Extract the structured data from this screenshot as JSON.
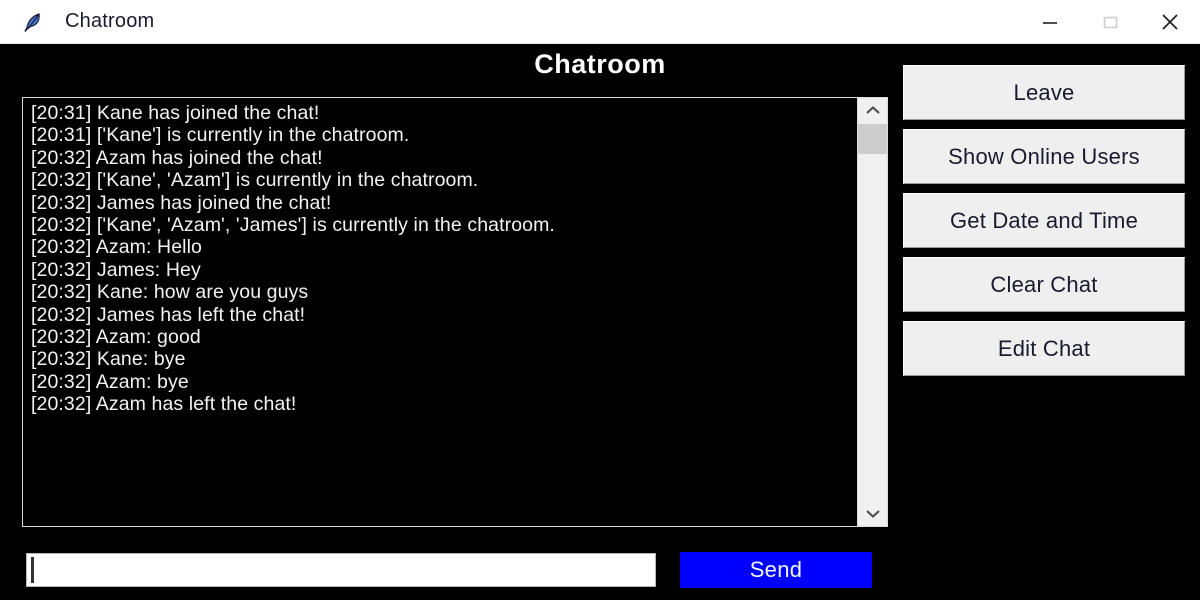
{
  "window": {
    "title": "Chatroom",
    "icon": "feather-icon",
    "controls": [
      {
        "name": "minimize-button",
        "glyph": "minimize-icon"
      },
      {
        "name": "maximize-button",
        "glyph": "maximize-icon"
      },
      {
        "name": "close-button",
        "glyph": "close-icon"
      }
    ]
  },
  "heading": "Chatroom",
  "chat": {
    "lines": [
      "[20:31] Kane has joined the chat!",
      "[20:31] ['Kane'] is currently in the chatroom.",
      "[20:32] Azam has joined the chat!",
      "[20:32] ['Kane', 'Azam'] is currently in the chatroom.",
      "[20:32] James has joined the chat!",
      "[20:32] ['Kane', 'Azam', 'James'] is currently in the chatroom.",
      "[20:32] Azam: Hello",
      "[20:32] James: Hey",
      "[20:32] Kane: how are you guys",
      "[20:32] James has left the chat!",
      "[20:32] Azam: good",
      "[20:32] Kane: bye",
      "[20:32] Azam: bye",
      "[20:32] Azam has left the chat!"
    ],
    "scrollbar": {
      "up_arrow": "chevron-up-icon",
      "down_arrow": "chevron-down-icon"
    }
  },
  "buttons": [
    {
      "name": "leave-button",
      "label": "Leave"
    },
    {
      "name": "show-online-users-button",
      "label": "Show Online Users"
    },
    {
      "name": "get-date-and-time-button",
      "label": "Get Date and Time"
    },
    {
      "name": "clear-chat-button",
      "label": "Clear Chat"
    },
    {
      "name": "edit-chat-button",
      "label": "Edit Chat"
    }
  ],
  "composer": {
    "message_value": "",
    "send_label": "Send"
  },
  "colors": {
    "window_background": "#000000",
    "titlebar": "#ffffff",
    "chat_text": "#f2f2f2",
    "button_face": "#efefef",
    "send_button": "#0000ff"
  }
}
